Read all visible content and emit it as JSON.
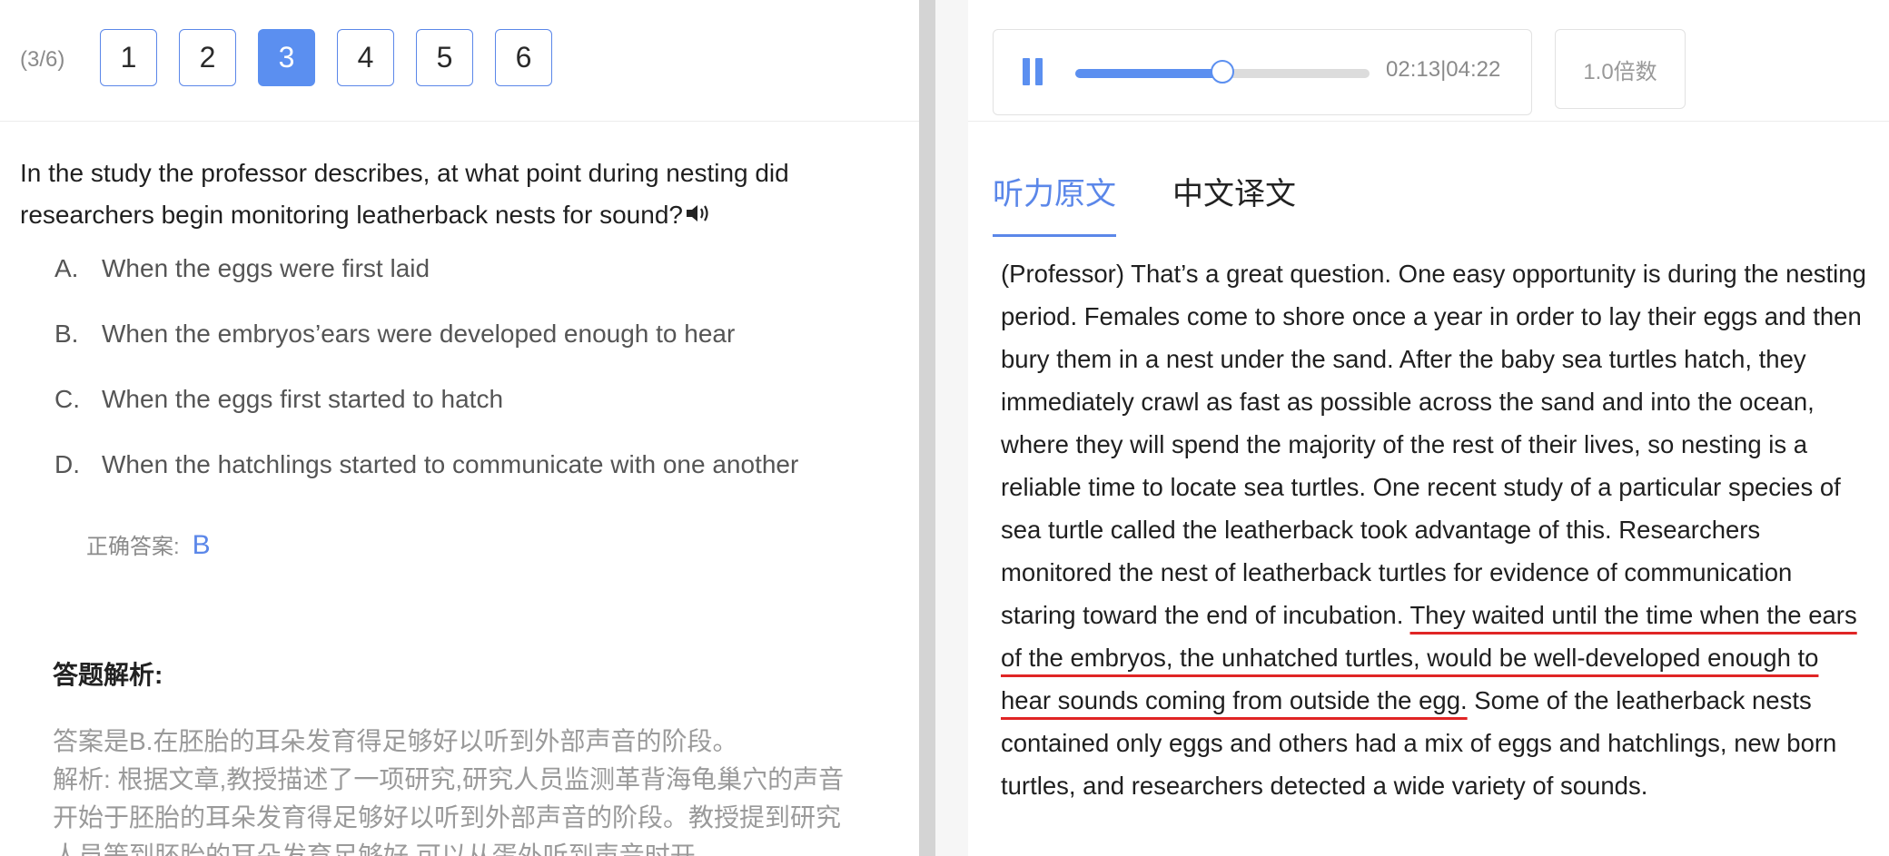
{
  "question_nav": {
    "progress": "(3/6)",
    "buttons": [
      "1",
      "2",
      "3",
      "4",
      "5",
      "6"
    ],
    "active_index": 2
  },
  "question": {
    "text": "In the study the professor describes, at what point during nesting did researchers begin monitoring leatherback nests for sound?",
    "speaker_icon": "speaker-icon"
  },
  "options": [
    {
      "letter": "A.",
      "text": "When the eggs were first laid"
    },
    {
      "letter": "B.",
      "text": "When the embryos’ears were developed enough to hear"
    },
    {
      "letter": "C.",
      "text": "When the eggs first started to hatch"
    },
    {
      "letter": "D.",
      "text": "When the hatchlings started to communicate with one another"
    }
  ],
  "answer": {
    "label": "正确答案:",
    "value": "B"
  },
  "analysis": {
    "title": "答题解析:",
    "line1": "答案是B.在胚胎的耳朵发育得足够好以听到外部声音的阶段。",
    "line2": "解析: 根据文章,教授描述了一项研究,研究人员监测革背海龟巢穴的声音开始于胚胎的耳朵发育得足够好以听到外部声音的阶段。教授提到研究人员等到胚胎的耳朵发育足够好,可以从蛋外听到声音时开"
  },
  "player": {
    "icon": "pause-icon",
    "current": "02:13",
    "separator": "|",
    "total": "04:22",
    "progress_fraction": 0.5,
    "speed_label": "1.0倍数"
  },
  "tabs": [
    {
      "label": "听力原文",
      "active": true
    },
    {
      "label": "中文译文",
      "active": false
    }
  ],
  "transcript": {
    "before": "(Professor) That’s a great question. One easy opportunity is during the nesting period. Females come to shore once a year in order to lay their eggs and then bury them in a nest under the sand. After the baby sea turtles hatch, they immediately crawl as fast as possible across the sand and into the ocean, where they will spend the majority of the rest of their lives, so nesting is a reliable time to locate sea turtles. One recent study of a particular species of sea turtle called the leatherback took advantage of this. Researchers monitored the nest of leatherback turtles for evidence of communication staring toward the end of incubation. ",
    "highlight": "They waited until the time when the ears of the embryos, the unhatched turtles, would be well-developed enough to hear sounds coming from outside the egg.",
    "after": " Some of the leatherback nests contained only eggs and others had a mix of eggs and hatchlings, new born turtles, and researchers detected a wide variety of sounds.",
    "highlight_color": "#e02525"
  },
  "colors": {
    "accent": "#5b8ff0",
    "highlight": "#e02525"
  }
}
